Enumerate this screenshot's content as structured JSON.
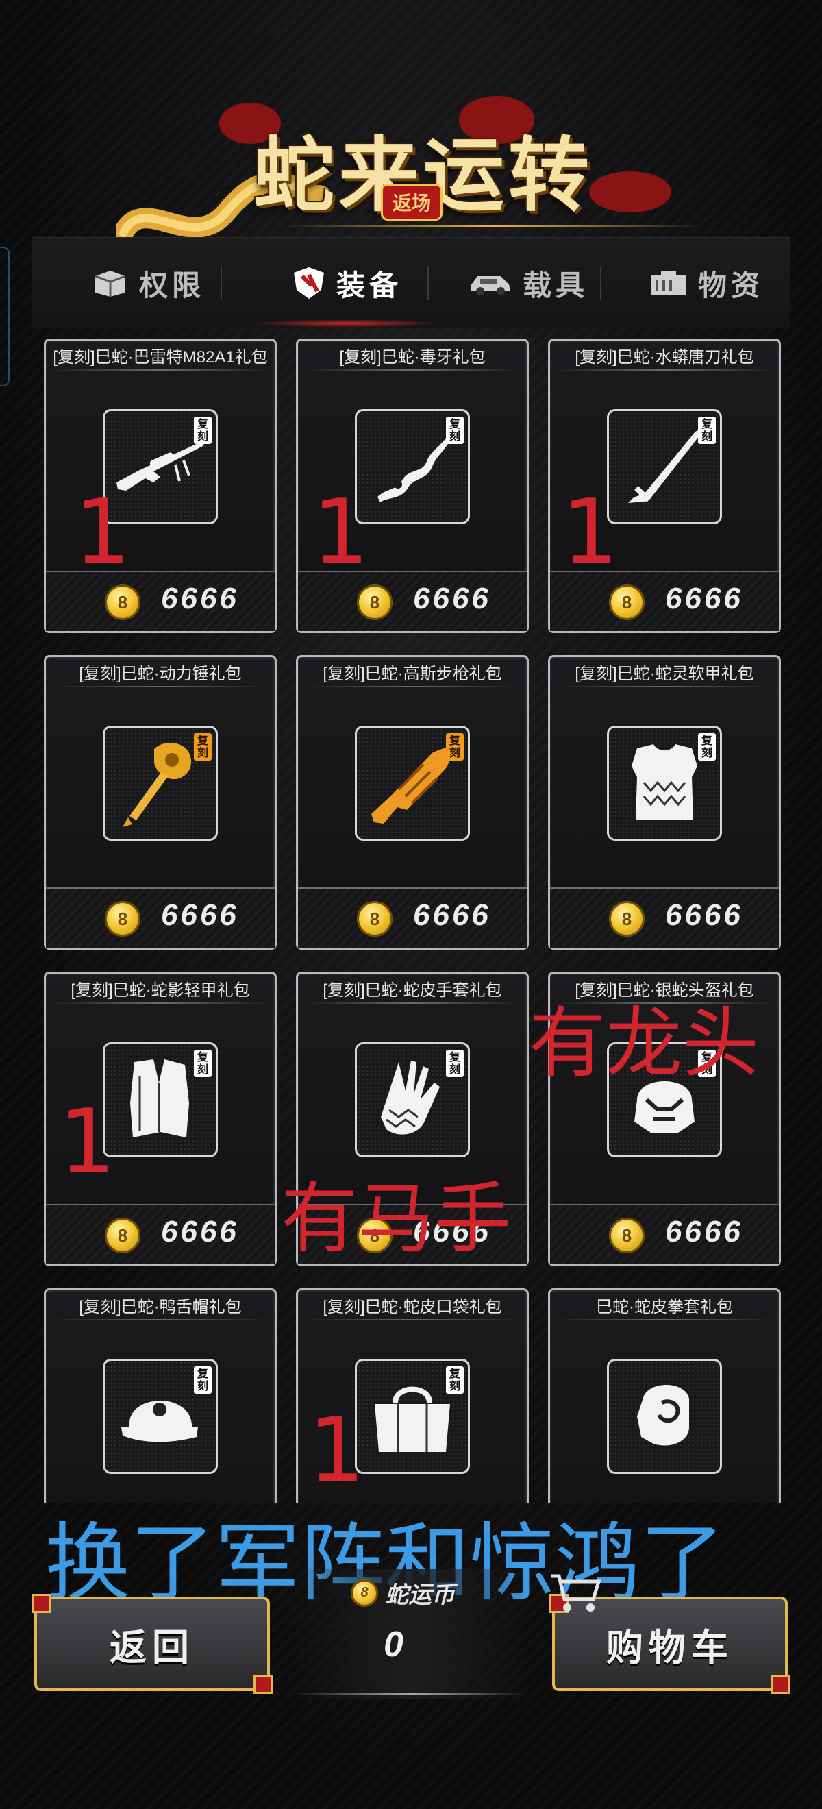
{
  "header": {
    "title": "蛇来运转",
    "badge": "返场"
  },
  "tabs": [
    {
      "label": "权限",
      "icon": "box-icon"
    },
    {
      "label": "装备",
      "icon": "shield-icon",
      "active": true
    },
    {
      "label": "载具",
      "icon": "car-icon"
    },
    {
      "label": "物资",
      "icon": "supply-crate-icon"
    }
  ],
  "cards": [
    {
      "title": "[复刻]巳蛇·巴雷特M82A1礼包",
      "icon": "sniper-rifle-icon",
      "tag": "复刻",
      "price": "6666"
    },
    {
      "title": "[复刻]巳蛇·毒牙礼包",
      "icon": "fang-blade-icon",
      "tag": "复刻",
      "price": "6666"
    },
    {
      "title": "[复刻]巳蛇·水蟒唐刀礼包",
      "icon": "tang-sword-icon",
      "tag": "复刻",
      "price": "6666"
    },
    {
      "title": "[复刻]巳蛇·动力锤礼包",
      "icon": "power-hammer-icon",
      "tag": "复刻",
      "price": "6666"
    },
    {
      "title": "[复刻]巳蛇·高斯步枪礼包",
      "icon": "gauss-rifle-icon",
      "tag": "复刻",
      "price": "6666"
    },
    {
      "title": "[复刻]巳蛇·蛇灵软甲礼包",
      "icon": "soft-armor-icon",
      "tag": "复刻",
      "price": "6666"
    },
    {
      "title": "[复刻]巳蛇·蛇影轻甲礼包",
      "icon": "light-armor-icon",
      "tag": "复刻",
      "price": "6666"
    },
    {
      "title": "[复刻]巳蛇·蛇皮手套礼包",
      "icon": "gloves-icon",
      "tag": "复刻",
      "price": "6666"
    },
    {
      "title": "[复刻]巳蛇·银蛇头盔礼包",
      "icon": "helmet-icon",
      "tag": "复刻",
      "price": "6666"
    },
    {
      "title": "[复刻]巳蛇·鸭舌帽礼包",
      "icon": "cap-icon",
      "tag": "复刻",
      "price": ""
    },
    {
      "title": "[复刻]巳蛇·蛇皮口袋礼包",
      "icon": "bag-icon",
      "tag": "复刻",
      "price": ""
    },
    {
      "title": "巳蛇·蛇皮拳套礼包",
      "icon": "boxing-glove-icon",
      "tag": "",
      "price": ""
    }
  ],
  "annotations": {
    "marks": [
      "1",
      "1",
      "1",
      "1",
      "1"
    ],
    "dragon_note": "有龙头",
    "horse_note": "有马手",
    "bottom_note": "换了军阵和惊鸿了"
  },
  "footer": {
    "back_label": "返回",
    "cart_label": "购物车",
    "currency_label": "蛇运币",
    "currency_value": "0"
  },
  "colors": {
    "accent_gold": "#e3b84a",
    "annotation_red": "#d2252e",
    "annotation_blue": "#3d9be6",
    "title_gold": "#f6e2a4"
  }
}
